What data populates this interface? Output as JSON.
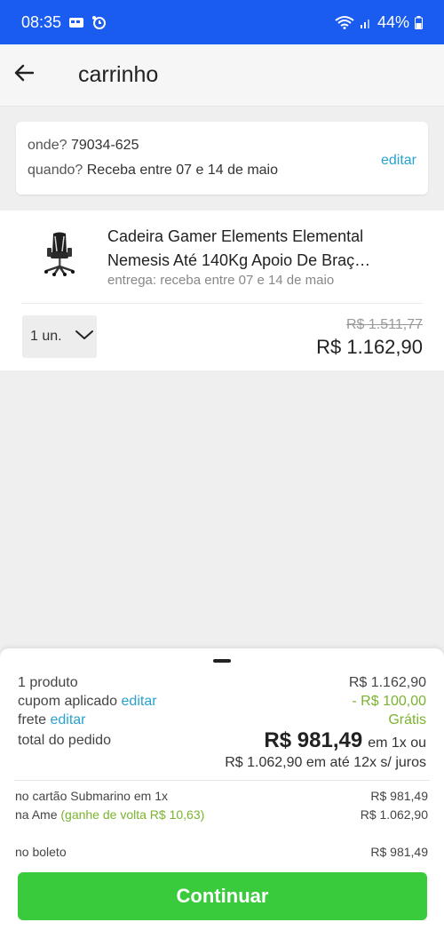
{
  "status_bar": {
    "time": "08:35",
    "battery": "44%",
    "icons": [
      "calendar-icon",
      "alarm-icon",
      "wifi-icon",
      "signal-icon",
      "battery-icon"
    ]
  },
  "header": {
    "title": "carrinho",
    "back_icon": "arrow-left-icon"
  },
  "delivery": {
    "where_label": "onde?",
    "where_value": "79034-625",
    "when_label": "quando?",
    "when_value": "Receba entre 07 e 14 de maio",
    "edit_label": "editar"
  },
  "product": {
    "name_line1": "Cadeira Gamer Elements Elemental",
    "name_line2": "Nemesis Até 140Kg Apoio De Braç…",
    "delivery_text": "entrega: receba entre 07 e 14 de maio",
    "quantity": "1 un.",
    "old_price": "R$ 1.511,77",
    "price": "R$ 1.162,90",
    "image_icon": "gamer-chair-icon"
  },
  "summary": {
    "products_label": "1 produto",
    "products_value": "R$ 1.162,90",
    "coupon_label": "cupom aplicado",
    "coupon_edit": "editar",
    "coupon_value": "- R$ 100,00",
    "shipping_label": "frete",
    "shipping_edit": "editar",
    "shipping_value": "Grátis",
    "total_label": "total do pedido",
    "total_value": "R$ 981,49",
    "total_suffix": "em 1x ou",
    "installments": "R$ 1.062,90 em até 12x s/ juros",
    "card_label": "no cartão Submarino em 1x",
    "card_value": "R$ 981,49",
    "ame_label": "na Ame",
    "ame_cashback": "(ganhe de volta R$ 10,63)",
    "ame_value": "R$ 1.062,90",
    "boleto_label": "no boleto",
    "boleto_value": "R$ 981,49"
  },
  "cta": {
    "label": "Continuar"
  },
  "colors": {
    "status_bar": "#1b5cf0",
    "link": "#2aa2cf",
    "green_text": "#7bb32e",
    "cta": "#3acb3d"
  }
}
